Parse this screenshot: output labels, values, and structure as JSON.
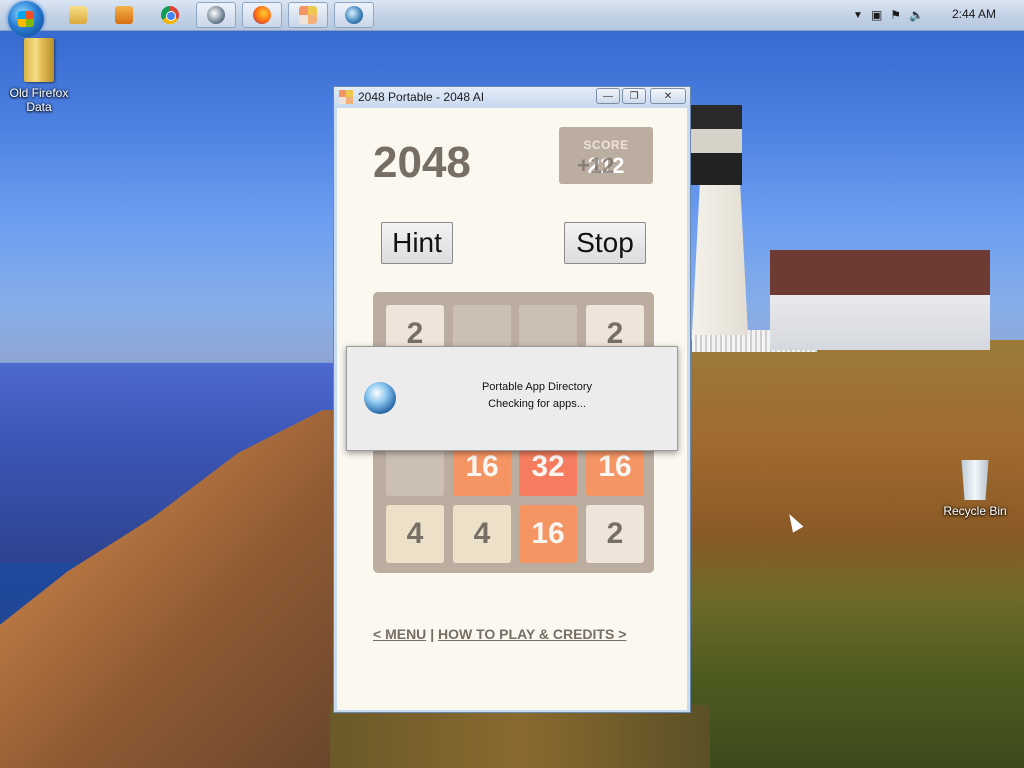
{
  "taskbar": {
    "pinned": [
      {
        "name": "windows-explorer",
        "icon": "folder-icon"
      },
      {
        "name": "media-player",
        "icon": "media-player-icon"
      },
      {
        "name": "chrome",
        "icon": "chrome-icon"
      },
      {
        "name": "app",
        "icon": "app-icon"
      },
      {
        "name": "firefox",
        "icon": "firefox-icon"
      },
      {
        "name": "2048-portable",
        "icon": "2048-icon"
      },
      {
        "name": "portable-app-directory",
        "icon": "globe-icon"
      }
    ],
    "clock": "2:44 AM"
  },
  "desktop": {
    "icons": [
      {
        "label": "Old Firefox Data"
      },
      {
        "label": "Recycle Bin"
      }
    ]
  },
  "window": {
    "title": "2048 Portable - 2048 AI",
    "minimize": "—",
    "maximize": "❐",
    "close": "✕"
  },
  "game": {
    "title": "2048",
    "score_label": "SCORE",
    "score_value": "212",
    "score_add": "+12",
    "hint_label": "Hint",
    "stop_label": "Stop",
    "board": [
      [
        "2",
        "",
        "",
        "2"
      ],
      [
        "",
        "",
        "",
        ""
      ],
      [
        "",
        "16",
        "32",
        "16"
      ],
      [
        "4",
        "4",
        "16",
        "2"
      ]
    ],
    "menu_link": "< MENU",
    "separator": "|",
    "credits_link": "HOW TO PLAY & CREDITS >"
  },
  "dialog": {
    "title": "Portable App Directory",
    "message": "Checking for apps..."
  }
}
